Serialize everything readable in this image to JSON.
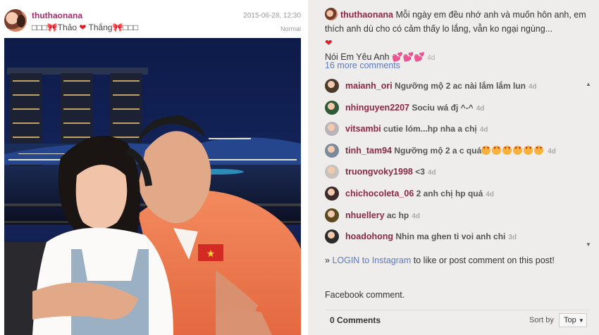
{
  "post": {
    "username": "thuthaonana",
    "caption_parts": [
      "□□□🎀Thảo ",
      "❤",
      " Thắng🎀□□□"
    ],
    "date": "2015-06-28, 12:30",
    "filter": "Normal"
  },
  "sidebar": {
    "top_comment": {
      "username": "thuthaonana",
      "text": "Mỗi ngày em đều nhớ anh và muốn hôn anh, em thích anh dù cho có cảm thấy lo lắng, vẫn ko ngại ngùng...",
      "heart": "❤",
      "line2": "Nói Em Yêu Anh",
      "hearts": "💕💕💕",
      "ago": "4d"
    },
    "more_comments": "16 more comments",
    "comments": [
      {
        "username": "maianh_ori",
        "text": "Ngưỡng mộ 2 ac nài lắm lắm lun",
        "ago": "4d",
        "color": "#4b3a2a"
      },
      {
        "username": "nhinguyen2207",
        "text": "Sociu wá đj ^-^",
        "ago": "4d",
        "color": "#2f5a3a"
      },
      {
        "username": "vitsambi",
        "text": "cutie lóm...hp nha a chị",
        "ago": "4d",
        "color": "#b9b3ba"
      },
      {
        "username": "tinh_tam94",
        "text": "Ngưỡng mộ 2 a c quá",
        "ago": "4d",
        "color": "#7a8a9a"
      },
      {
        "username": "truongvoky1998",
        "text": "<3",
        "ago": "4d",
        "color": "#c7c2bc"
      },
      {
        "username": "chichocoleta_06",
        "text": "2 anh chị hp quá",
        "ago": "4d",
        "color": "#3a2a2a"
      },
      {
        "username": "nhuellery",
        "text": "ac hp",
        "ago": "4d",
        "color": "#5b4a1e"
      },
      {
        "username": "hoadohong",
        "text": "Nhin ma ghen ti voi anh chi",
        "ago": "3d",
        "color": "#2b2b2b"
      }
    ],
    "login_prefix": "» ",
    "login_link": "LOGIN to Instagram",
    "login_suffix": " to like or post comment on this post!",
    "facebook_label": "Facebook comment.",
    "zero_comments": "0 Comments",
    "sort_by": "Sort by",
    "sort_value": "Top"
  }
}
